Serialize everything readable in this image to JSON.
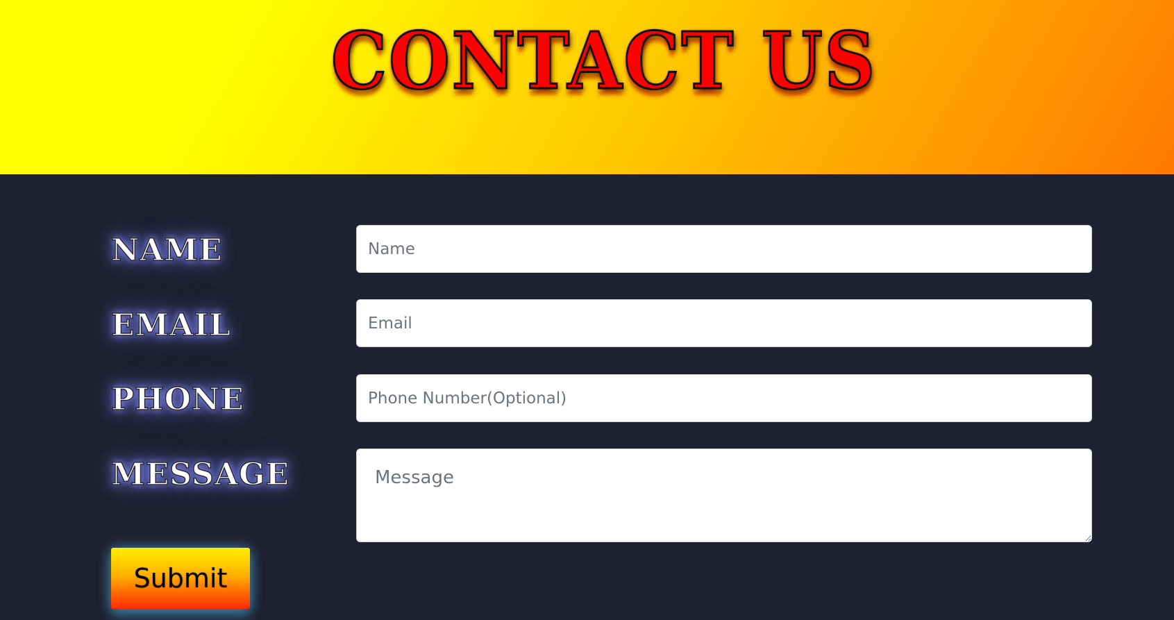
{
  "header": {
    "title": "CONTACT US"
  },
  "form": {
    "labels": {
      "name": "NAME",
      "email": "EMAIL",
      "phone": "PHONE",
      "message": "MESSAGE"
    },
    "fields": {
      "name": {
        "value": "",
        "placeholder": "Name"
      },
      "email": {
        "value": "",
        "placeholder": "Email"
      },
      "phone": {
        "value": "",
        "placeholder": "Phone Number(Optional)"
      },
      "message": {
        "value": "",
        "placeholder": "Message"
      }
    },
    "submit_label": "Submit"
  },
  "colors": {
    "header_gradient_start": "#ffff00",
    "header_gradient_end": "#ff7a00",
    "title_color": "#ff0000",
    "background": "#1f2130",
    "label_glow": "#8e96ff",
    "button_top": "#ffee00",
    "button_bottom": "#ff2a00"
  }
}
